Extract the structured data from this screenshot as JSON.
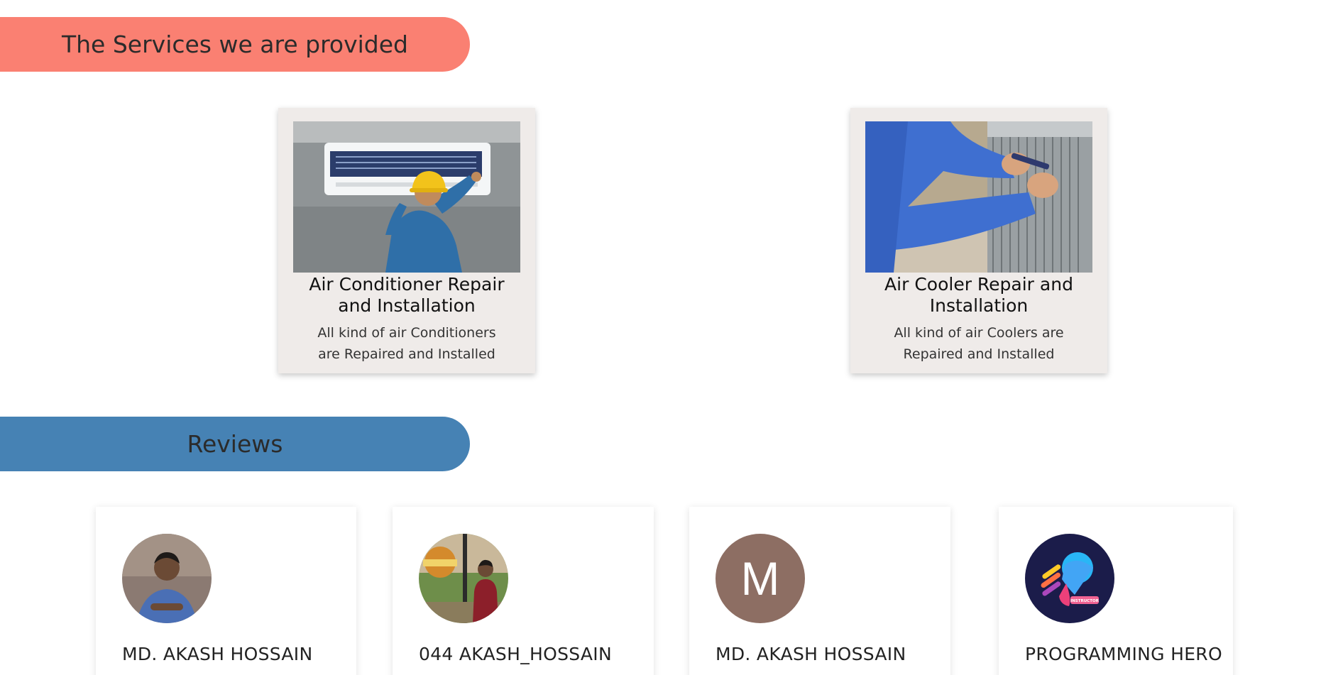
{
  "services_section": {
    "heading": "The Services we are provided",
    "color": "#fa8072",
    "cards": [
      {
        "image": "air-conditioner-technician-photo",
        "title": "Air Conditioner Repair and Installation",
        "description": "All kind of air Conditioners are Repaired and Installed"
      },
      {
        "image": "air-cooler-technician-photo",
        "title": "Air Cooler Repair and Installation",
        "description": "All kind of air Coolers are Repaired and Installed"
      }
    ]
  },
  "reviews_section": {
    "heading": "Reviews",
    "color": "#4682b4",
    "reviews": [
      {
        "avatar": "person-photo-avatar",
        "name": "MD. AKASH HOSSAIN"
      },
      {
        "avatar": "person-outdoor-photo-avatar",
        "name": "044 AKASH_HOSSAIN"
      },
      {
        "avatar": "letter-avatar",
        "avatar_letter": "M",
        "avatar_color": "#8d6e63",
        "name": "MD. AKASH HOSSAIN"
      },
      {
        "avatar": "programming-hero-logo-avatar",
        "avatar_badge": "INSTRUCTOR",
        "name": "PROGRAMMING HERO"
      }
    ]
  }
}
